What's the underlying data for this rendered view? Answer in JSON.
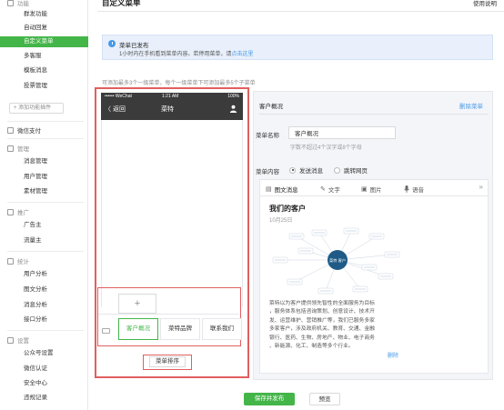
{
  "sidebar": {
    "group_function": "功能",
    "items_function": [
      "群发功能",
      "自动回复",
      "自定义菜单",
      "多客服",
      "模板消息",
      "投票管理"
    ],
    "add_plugin": "+ 添加功能插件",
    "pay": "微信支付",
    "group_manage": "管理",
    "items_manage": [
      "消息管理",
      "用户管理",
      "素材管理"
    ],
    "group_promo": "推广",
    "items_promo": [
      "广告主",
      "流量主"
    ],
    "group_stats": "统计",
    "items_stats": [
      "用户分析",
      "图文分析",
      "消息分析",
      "接口分析"
    ],
    "group_settings": "设置",
    "items_settings": [
      "公众号设置",
      "微信认证",
      "安全中心",
      "违规记录"
    ]
  },
  "header": {
    "title": "自定义菜单",
    "guide": "使用说明"
  },
  "notice": {
    "title": "菜单已发布",
    "desc": "1小时内在手机看到菜单内容。若停用菜单，请",
    "link": "点击这里"
  },
  "tips": "可添加最多3个一级菜单，每个一级菜单下可添加最多5个子菜单",
  "phone": {
    "carrier": "•••••• WeChat",
    "time": "1:21 AM",
    "battery": "100%",
    "back": "〈 返回",
    "title": "菜特"
  },
  "menu": {
    "add_symbol": "+",
    "tabs": [
      "客户概况",
      "菜特品牌",
      "联系我们"
    ],
    "selected_index": 0,
    "sort_button": "菜单排序"
  },
  "editor": {
    "menu_name": "客户概况",
    "delete_menu": "删除菜单",
    "name_label": "菜单名称",
    "name_value": "客户概况",
    "name_hint": "字数不超过4个汉字或8个字母",
    "content_label": "菜单内容",
    "radio_send": "发送消息",
    "radio_jump": "跳转网页",
    "tabs": [
      "图文消息",
      "文字",
      "图片",
      "语音"
    ],
    "more": "»",
    "article_title": "我们的客户",
    "article_date": "10月25日",
    "mindmap_center": "菜特 客户",
    "article_body": "菜特以为客户提供领先智性的全面服务为目标\n，服务体系包括咨询策划、创意设计、技术开\n发、运营维护、营销推广等，我们已服务多家\n多家客户，涉及政府机关、教育、交通、金融\n银行、医药、生物、房地产、物业、电子商务\n、新能源、化工、制造等多个行业。",
    "delete_article": "删除"
  },
  "footer": {
    "save": "保存并发布",
    "preview": "预览"
  },
  "colors": {
    "brand_green": "#44b549",
    "annotation_red": "#e15f5f",
    "link_blue": "#459ae9"
  }
}
